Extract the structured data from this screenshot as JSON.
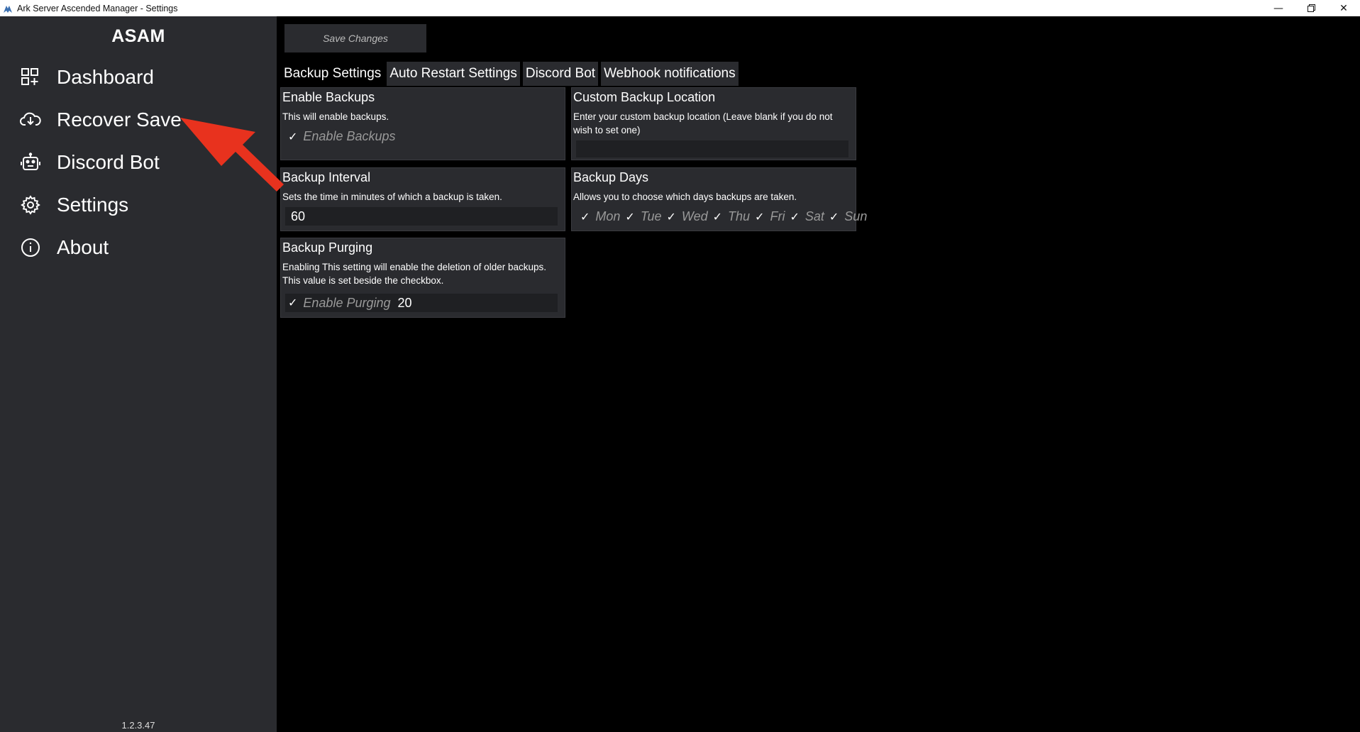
{
  "window": {
    "title": "Ark Server Ascended Manager - Settings",
    "minimize": "—",
    "maximize": "❐",
    "close": "✕"
  },
  "sidebar": {
    "brand": "ASAM",
    "items": [
      {
        "label": "Dashboard",
        "icon": "dashboard-grid-icon"
      },
      {
        "label": "Recover Save",
        "icon": "cloud-download-icon"
      },
      {
        "label": "Discord Bot",
        "icon": "bot-icon"
      },
      {
        "label": "Settings",
        "icon": "gear-icon"
      },
      {
        "label": "About",
        "icon": "info-icon"
      }
    ],
    "version": "1.2.3.47"
  },
  "main": {
    "save_label": "Save Changes",
    "tabs": [
      {
        "label": "Backup Settings",
        "active": true
      },
      {
        "label": "Auto Restart Settings",
        "active": false
      },
      {
        "label": "Discord Bot",
        "active": false
      },
      {
        "label": "Webhook notifications",
        "active": false
      }
    ],
    "cards": {
      "enable_backups": {
        "title": "Enable Backups",
        "desc": "This will enable backups.",
        "checkbox_label": "Enable Backups",
        "checked": true
      },
      "custom_location": {
        "title": "Custom Backup Location",
        "desc": "Enter your custom backup location (Leave blank if you do not wish to set one)",
        "value": ""
      },
      "interval": {
        "title": "Backup Interval",
        "desc": "Sets the time in minutes of which a backup is taken.",
        "value": "60"
      },
      "days": {
        "title": "Backup Days",
        "desc": "Allows you to choose which days backups are taken.",
        "days": [
          "Mon",
          "Tue",
          "Wed",
          "Thu",
          "Fri",
          "Sat",
          "Sun"
        ]
      },
      "purging": {
        "title": "Backup Purging",
        "desc_line1": "Enabling This setting will enable the deletion of older backups.",
        "desc_line2": "This value is set beside the checkbox.",
        "checkbox_label": "Enable Purging",
        "value": "20"
      }
    }
  },
  "colors": {
    "sidebar_bg": "#2a2b2f",
    "main_bg": "#000000",
    "card_bg": "#2a2b2f",
    "annotation_arrow": "#e8321e"
  }
}
